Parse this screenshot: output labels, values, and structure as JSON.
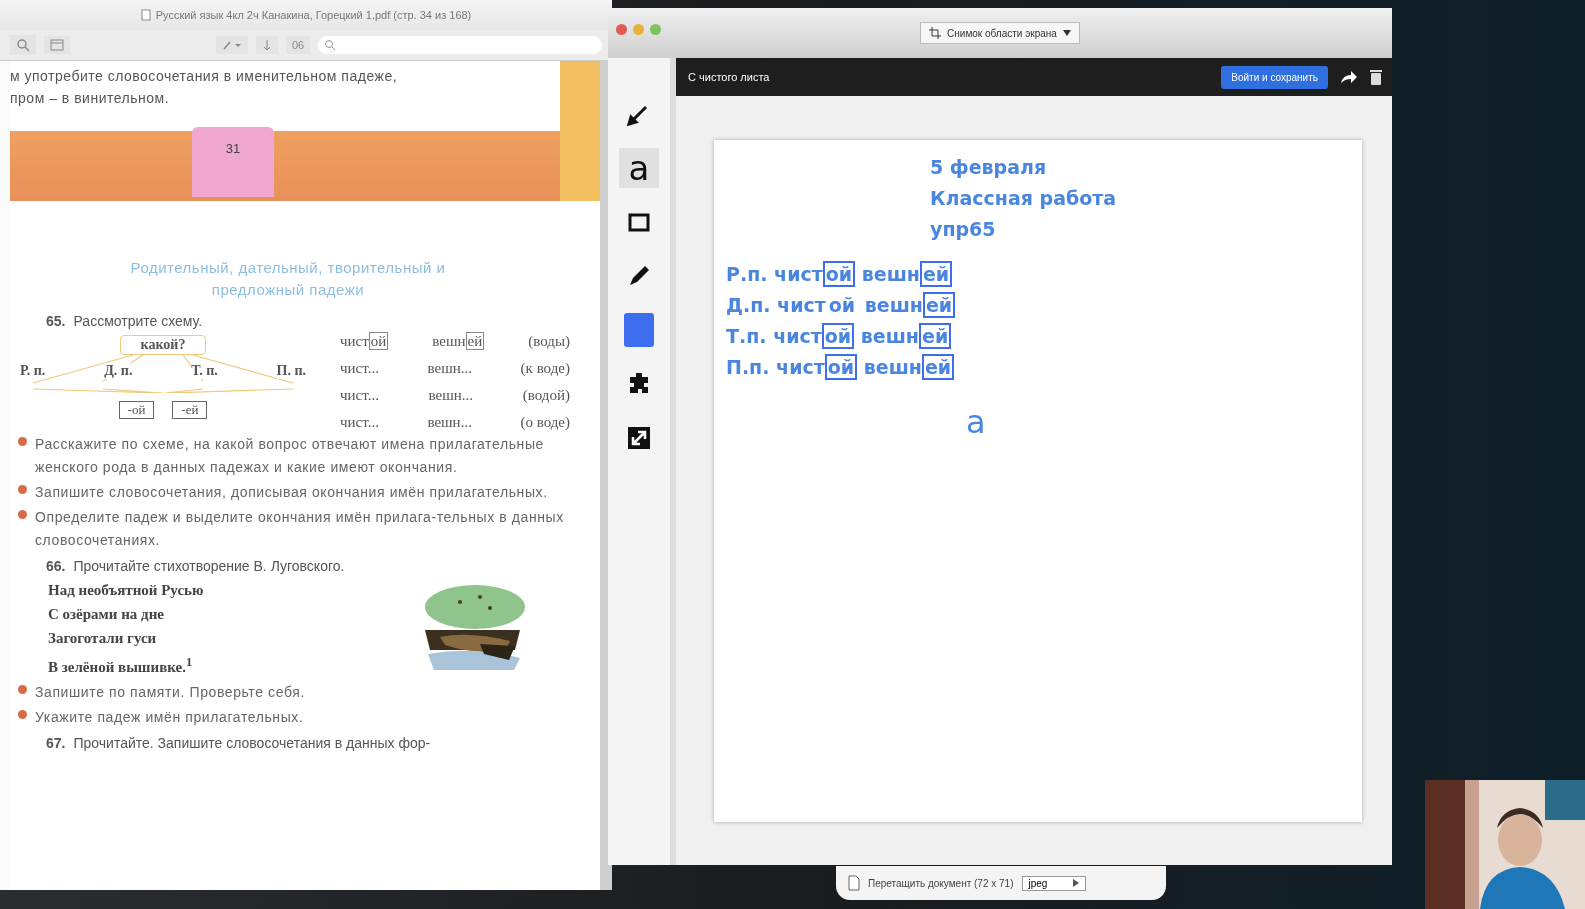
{
  "pdf_viewer": {
    "title": "Русский язык 4кл 2ч Канакина, Горецкий 1.pdf (стр. 34 из 168)",
    "toolbar_label": "06",
    "page": {
      "top_lines": [
        "м употребите словосочетания в именительном падеже,",
        "пром – в винительном."
      ],
      "page_number": "31",
      "section_title": "Родительный, дательный, творительный и предложный падежи",
      "exercises": [
        {
          "number": "65.",
          "text": "Рассмотрите схему.",
          "scheme": {
            "question": "какой?",
            "cases": [
              "Р. п.",
              "Д. п.",
              "Т. п.",
              "П. п."
            ],
            "endings": [
              "-ой",
              "-ей"
            ]
          },
          "phrases": [
            [
              {
                "text": "чист",
                "ending": "ой"
              },
              {
                "text": "вешн",
                "ending": "ей"
              },
              {
                "text": "(воды)"
              }
            ],
            [
              {
                "text": "чист..."
              },
              {
                "text": "вешн..."
              },
              {
                "text": "(к воде)"
              }
            ],
            [
              {
                "text": "чист..."
              },
              {
                "text": "вешн..."
              },
              {
                "text": "(водой)"
              }
            ],
            [
              {
                "text": "чист..."
              },
              {
                "text": "вешн..."
              },
              {
                "text": "(о воде)"
              }
            ]
          ],
          "tasks": [
            "Расскажите по схеме, на какой вопрос отвечают имена прилагательные женского рода в данных падежах и какие имеют окончания.",
            "Запишите словосочетания, дописывая окончания имён прилагательных.",
            "Определите падеж и выделите окончания имён прилага-тельных в данных словосочетаниях."
          ]
        },
        {
          "number": "66.",
          "text": "Прочитайте стихотворение В. Луговского.",
          "poem": [
            "Над необъятной Русью",
            "С озёрами на дне",
            "Загоготали гуси",
            "В зелёной вышивке.$^{1}$"
          ],
          "illustration": {
            "kind": "picture"
          },
          "tasks": [
            "Запишите по памяти. Проверьте себя.",
            "Укажите падеж имён прилагательных."
          ]
        },
        {
          "number": "67.",
          "text": "Прочитайте. Запишите словосочетания в данных фор-"
        }
      ]
    }
  },
  "whiteboard": {
    "toolbar_button": "Снимок области экрана",
    "header_title": "С чистого листа",
    "signin_button": "Войти и сохранить",
    "tools": [
      {
        "kind": "pen",
        "selected": false
      },
      {
        "kind": "text",
        "label": "a",
        "selected": true
      },
      {
        "kind": "rectangle",
        "selected": false
      },
      {
        "kind": "marker",
        "selected": false
      },
      {
        "kind": "color",
        "color": "#3d6ef0",
        "selected": false
      },
      {
        "kind": "puzzle",
        "selected": false
      },
      {
        "kind": "resize",
        "selected": false
      }
    ],
    "canvas": {
      "heading": [
        "5 февраля",
        "Классная работа",
        "упр65"
      ],
      "rows": [
        {
          "case": "Р.п.",
          "words": [
            {
              "stem": "чист",
              "ending": "ой",
              "boxed": true
            },
            {
              "stem": "вешн",
              "ending": "ей",
              "boxed": true
            }
          ]
        },
        {
          "case": "Д.п.",
          "words": [
            {
              "stem": "чист",
              "ending": "ой",
              "boxed": false
            },
            {
              "stem": "вешн",
              "ending": "ей",
              "boxed": true
            }
          ]
        },
        {
          "case": "Т.п.",
          "words": [
            {
              "stem": "чист",
              "ending": "ой",
              "boxed": true
            },
            {
              "stem": "вешн",
              "ending": "ей",
              "boxed": true
            }
          ]
        },
        {
          "case": "П.п.",
          "words": [
            {
              "stem": "чист",
              "ending": "ой",
              "boxed": true
            },
            {
              "stem": "вешн",
              "ending": "ей",
              "boxed": true
            }
          ]
        }
      ],
      "text_cursor": "a"
    },
    "bottom_bar": {
      "label": "Перетащить документ (72 x 71)",
      "format": "jpeg"
    }
  },
  "webcam": {
    "kind": "picture"
  }
}
